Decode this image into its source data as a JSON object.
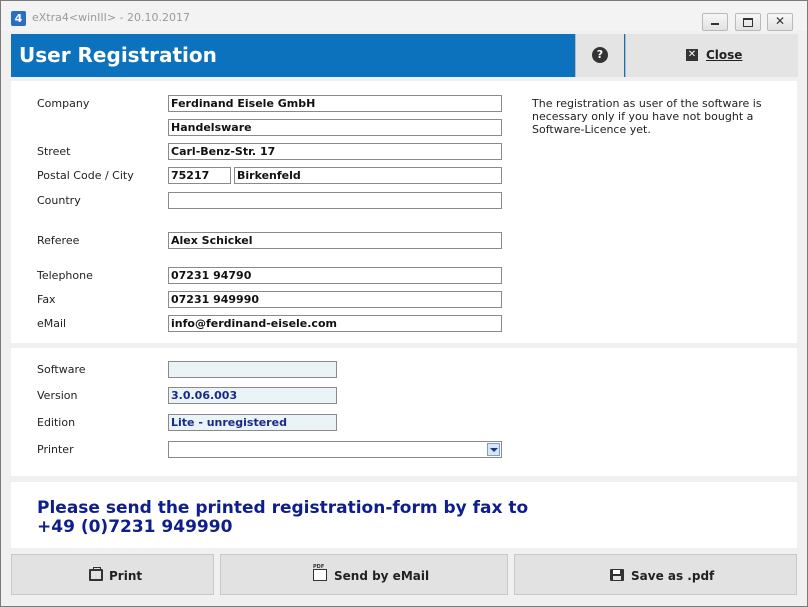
{
  "window": {
    "title": "eXtra4<winIII>  -  20.10.2017",
    "icon_letter": "4"
  },
  "header": {
    "title": "User Registration",
    "help_icon": "question-circle-icon",
    "close_label": "Close",
    "accent_color": "#0c72be"
  },
  "form": {
    "labels": {
      "company": "Company",
      "street": "Street",
      "postal_city": "Postal Code / City",
      "country": "Country",
      "referee": "Referee",
      "telephone": "Telephone",
      "fax": "Fax",
      "email": "eMail"
    },
    "values": {
      "company_1": "Ferdinand Eisele GmbH",
      "company_2": "Handelsware",
      "street": "Carl-Benz-Str. 17",
      "postal_code": "75217",
      "city": "Birkenfeld",
      "country": "",
      "referee": "Alex Schickel",
      "telephone": "07231 94790",
      "fax": "07231 949990",
      "email": "info@ferdinand-eisele.com"
    },
    "note": "The registration as user of the software is necessary only if you have not bought a Software-Licence yet."
  },
  "software": {
    "labels": {
      "software": "Software",
      "version": "Version",
      "edition": "Edition",
      "printer": "Printer"
    },
    "values": {
      "software": "",
      "version": "3.0.06.003",
      "edition": "Lite - unregistered",
      "printer": ""
    }
  },
  "message": {
    "text": "Please send the printed registration-form by fax to +49 (0)7231 949990"
  },
  "buttons": {
    "print": "Print",
    "email": "Send by eMail",
    "pdf": "Save as .pdf"
  }
}
